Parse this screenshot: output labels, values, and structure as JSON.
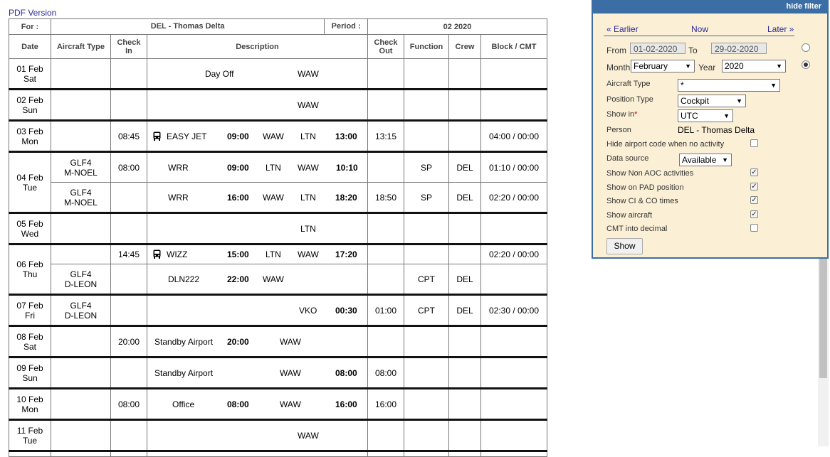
{
  "pdf_link": "PDF Version",
  "header": {
    "for_label": "For :",
    "for_value": "DEL - Thomas Delta",
    "period_label": "Period :",
    "period_value": "02 2020"
  },
  "columns": {
    "date": "Date",
    "aircraft": "Aircraft Type",
    "checkin_1": "Check",
    "checkin_2": "In",
    "description": "Description",
    "checkout_1": "Check",
    "checkout_2": "Out",
    "function": "Function",
    "crew": "Crew",
    "block": "Block / CMT"
  },
  "rows": {
    "r01": {
      "day": "01 Feb",
      "wd": "Sat",
      "title": "Day Off",
      "from": "WAW"
    },
    "r02": {
      "day": "02 Feb",
      "wd": "Sun",
      "from": "WAW"
    },
    "r03": {
      "day": "03 Feb",
      "wd": "Mon",
      "checkin": "08:45",
      "title": "EASY JET",
      "dep": "09:00",
      "from": "WAW",
      "to": "LTN",
      "arr": "13:00",
      "checkout": "13:15",
      "block": "04:00 / 00:00"
    },
    "r04a": {
      "day": "04 Feb",
      "wd": "Tue",
      "ac1": "GLF4",
      "ac2": "M-NOEL",
      "checkin": "08:00",
      "title": "WRR",
      "dep": "09:00",
      "from": "LTN",
      "to": "WAW",
      "arr": "10:10",
      "function": "SP",
      "crew": "DEL",
      "block": "01:10 / 00:00"
    },
    "r04b": {
      "ac1": "GLF4",
      "ac2": "M-NOEL",
      "title": "WRR",
      "dep": "16:00",
      "from": "WAW",
      "to": "LTN",
      "arr": "18:20",
      "checkout": "18:50",
      "function": "SP",
      "crew": "DEL",
      "block": "02:20 / 00:00"
    },
    "r05": {
      "day": "05 Feb",
      "wd": "Wed",
      "to": "LTN"
    },
    "r06a": {
      "day": "06 Feb",
      "wd": "Thu",
      "checkin": "14:45",
      "title": "WIZZ",
      "dep": "15:00",
      "from": "LTN",
      "to": "WAW",
      "arr": "17:20",
      "block": "02:20 / 00:00"
    },
    "r06b": {
      "ac1": "GLF4",
      "ac2": "D-LEON",
      "title": "DLN222",
      "dep": "22:00",
      "from": "WAW",
      "function": "CPT",
      "crew": "DEL"
    },
    "r07": {
      "day": "07 Feb",
      "wd": "Fri",
      "ac1": "GLF4",
      "ac2": "D-LEON",
      "to": "VKO",
      "arr": "00:30",
      "checkout": "01:00",
      "function": "CPT",
      "crew": "DEL",
      "block": "02:30 / 00:00"
    },
    "r08": {
      "day": "08 Feb",
      "wd": "Sat",
      "checkin": "20:00",
      "title": "Standby Airport",
      "dep": "20:00",
      "from": "WAW"
    },
    "r09": {
      "day": "09 Feb",
      "wd": "Sun",
      "title": "Standby Airport",
      "from": "WAW",
      "arr": "08:00",
      "checkout": "08:00"
    },
    "r10": {
      "day": "10 Feb",
      "wd": "Mon",
      "checkin": "08:00",
      "title": "Office",
      "dep": "08:00",
      "from": "WAW",
      "arr": "16:00",
      "checkout": "16:00"
    },
    "r11": {
      "day": "11 Feb",
      "wd": "Tue",
      "from": "WAW"
    }
  },
  "filter": {
    "hide_label": "hide filter",
    "earlier": "« Earlier",
    "now": "Now",
    "later": "Later »",
    "from_label": "From",
    "from_value": "01-02-2020",
    "to_label": "To",
    "to_value": "29-02-2020",
    "month_label": "Month",
    "month_value": "February",
    "year_label": "Year",
    "year_value": "2020",
    "aircraft_type_label": "Aircraft Type",
    "aircraft_type_value": "*",
    "position_type_label": "Position Type",
    "position_type_value": "Cockpit",
    "show_in_label": "Show in",
    "show_in_required": "*",
    "show_in_value": "UTC",
    "person_label": "Person",
    "person_value": "DEL - Thomas Delta",
    "hide_airport_label": "Hide airport code when no activity",
    "data_source_label": "Data source",
    "data_source_value": "Available",
    "non_aoc_label": "Show Non AOC activities",
    "pad_label": "Show on PAD position",
    "ci_co_label": "Show CI & CO times",
    "aircraft_label": "Show aircraft",
    "cmt_label": "CMT into decimal",
    "show_button": "Show",
    "check_mark": "✓"
  }
}
